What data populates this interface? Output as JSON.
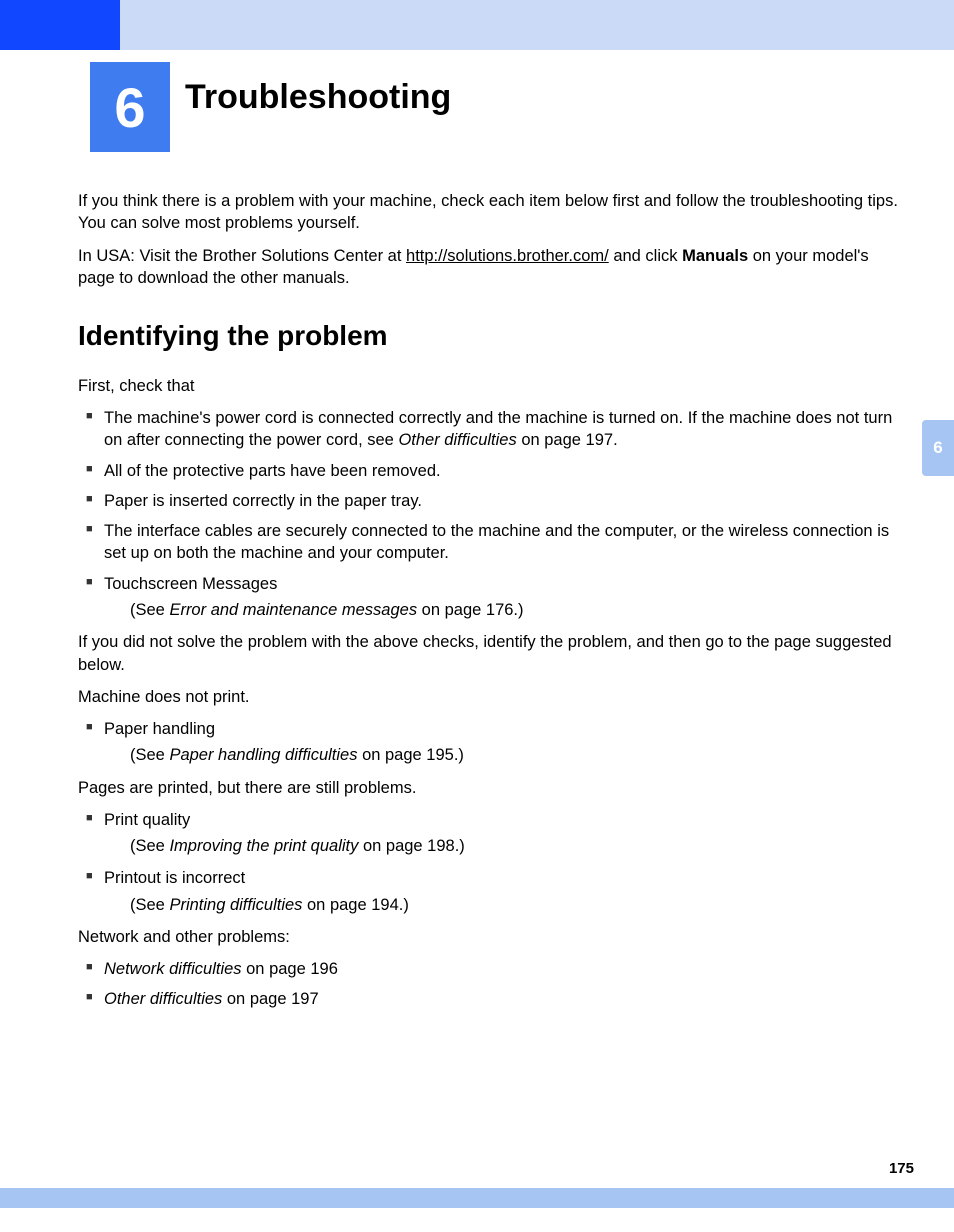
{
  "chapter": {
    "number": "6",
    "title": "Troubleshooting"
  },
  "intro": {
    "p1": "If you think there is a problem with your machine, check each item below first and follow the troubleshooting tips. You can solve most problems yourself.",
    "p2a": "In USA: Visit the Brother Solutions Center at ",
    "link": "http://solutions.brother.com/",
    "p2b": " and click ",
    "bold": "Manuals",
    "p2c": " on your model's page to download the other manuals."
  },
  "section": {
    "heading": "Identifying the problem",
    "lead": "First, check that",
    "bullets1": {
      "b1a": "The machine's power cord is connected correctly and the machine is turned on. If the machine does not turn on after connecting the power cord, see ",
      "b1i": "Other difficulties",
      "b1b": " on page 197.",
      "b2": "All of the protective parts have been removed.",
      "b3": "Paper is inserted correctly in the paper tray.",
      "b4": "The interface cables are securely connected to the machine and the computer, or the wireless connection is set up on both the machine and your computer.",
      "b5": "Touchscreen Messages",
      "b5s_a": "(See ",
      "b5s_i": "Error and maintenance messages",
      "b5s_b": " on page 176.)"
    },
    "p_after": "If you did not solve the problem with the above checks, identify the problem, and then go to the page suggested below.",
    "mach": "Machine does not print.",
    "ph": "Paper handling",
    "ph_s_a": "(See ",
    "ph_s_i": "Paper handling difficulties",
    "ph_s_b": " on page 195.)",
    "pages": "Pages are printed, but there are still problems.",
    "pq": "Print quality",
    "pq_s_a": "(See ",
    "pq_s_i": "Improving the print quality",
    "pq_s_b": " on page 198.)",
    "pi": "Printout is incorrect",
    "pi_s_a": "(See ",
    "pi_s_i": "Printing difficulties",
    "pi_s_b": " on page 194.)",
    "net": "Network and other problems:",
    "nd_i": "Network difficulties",
    "nd_b": " on page 196",
    "od_i": "Other difficulties",
    "od_b": " on page 197"
  },
  "sideTab": "6",
  "pageNumber": "175"
}
